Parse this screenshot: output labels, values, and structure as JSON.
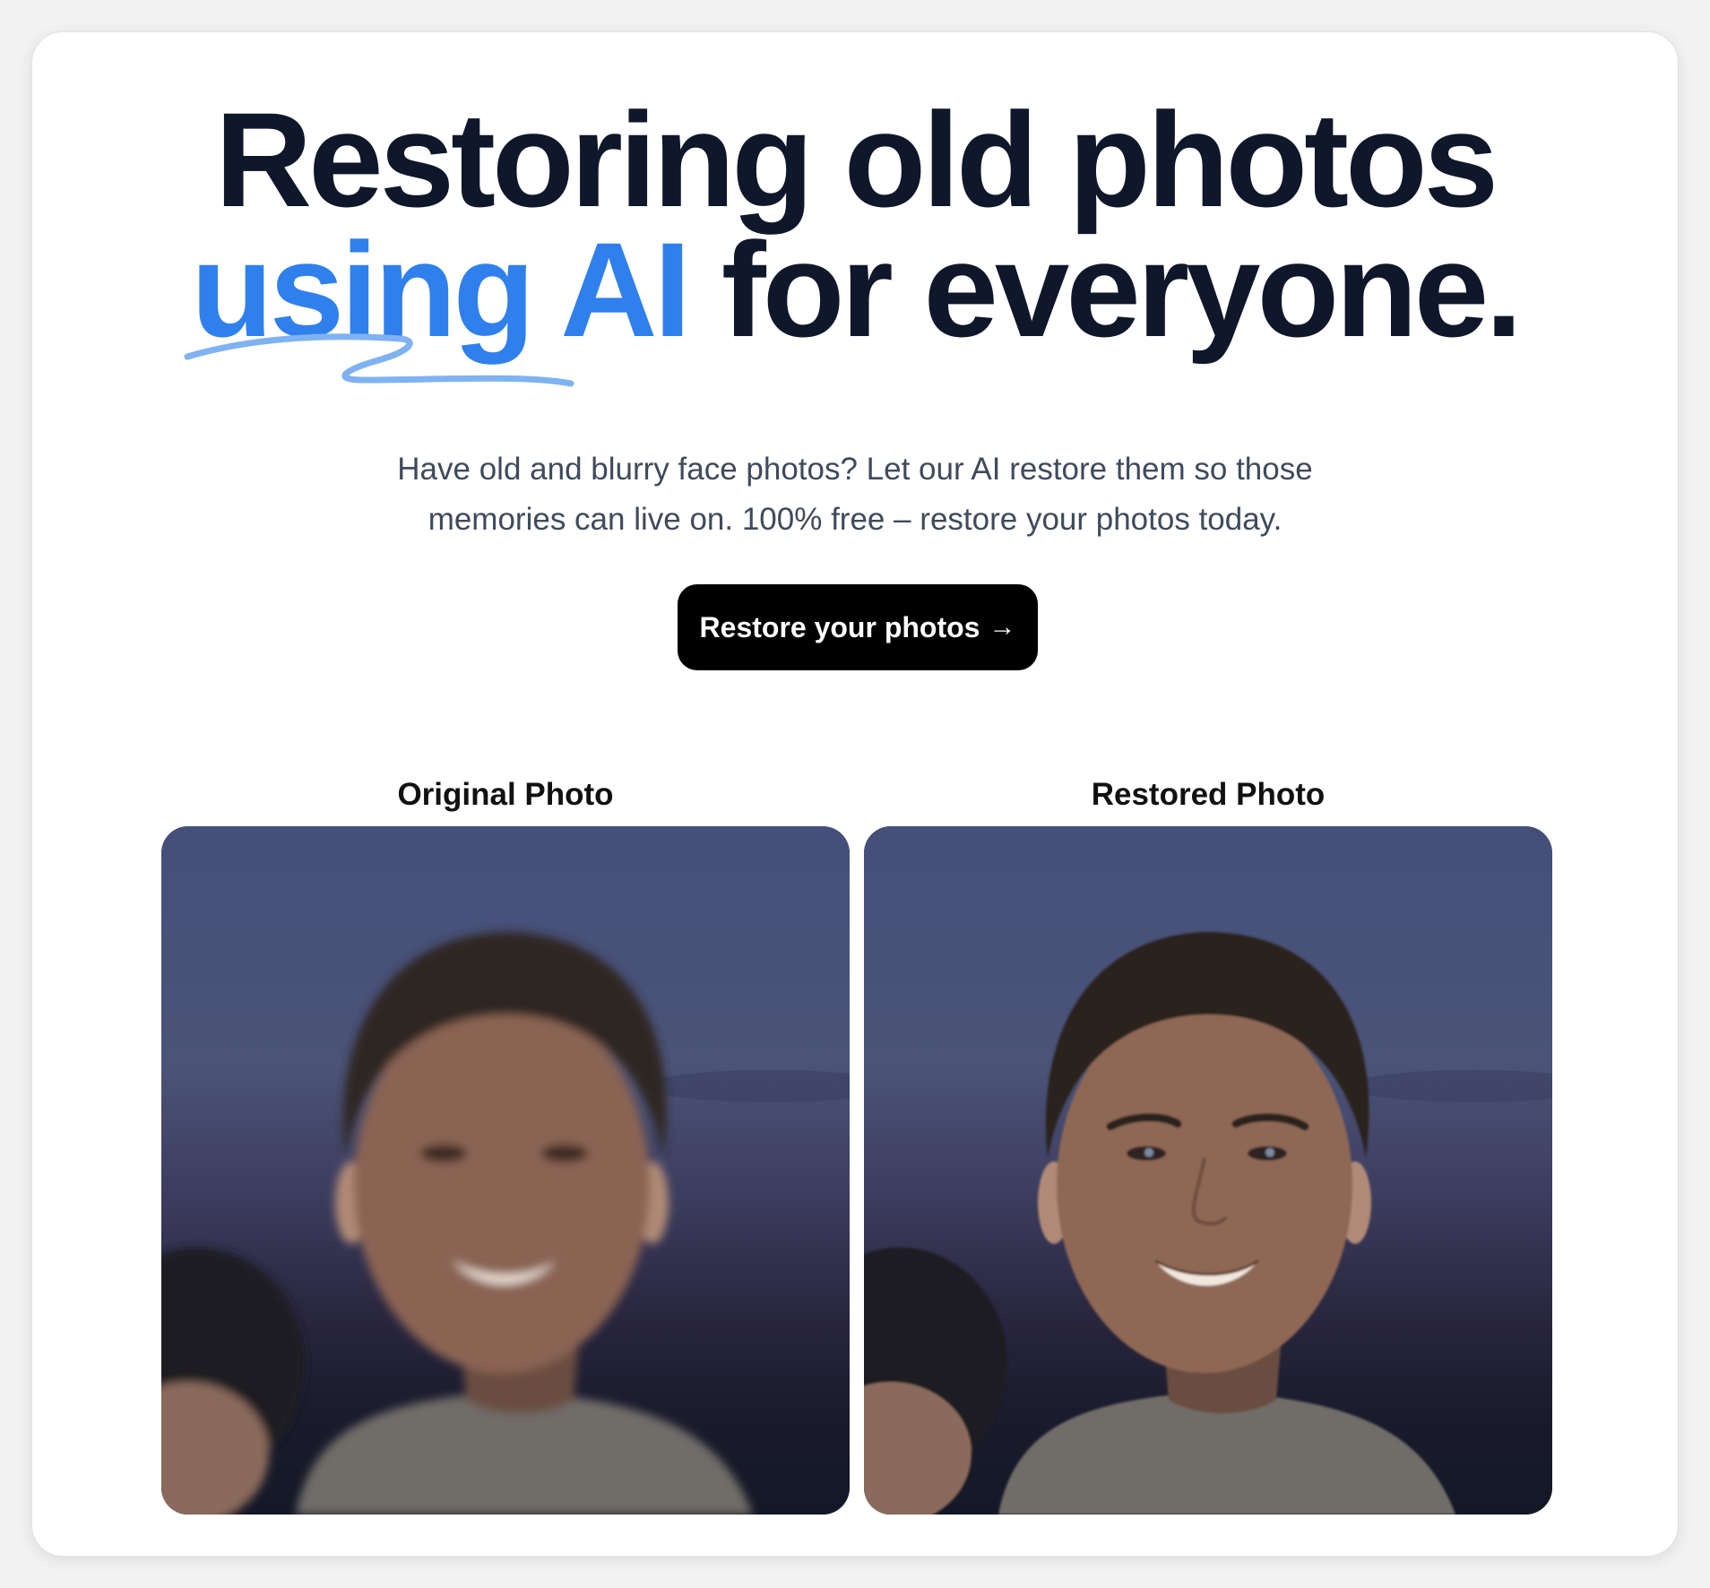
{
  "hero": {
    "headline_line1": "Restoring old photos",
    "headline_accent": "using AI",
    "headline_rest": " for everyone.",
    "subtitle_line1": "Have old and blurry face photos? Let our AI restore them so those",
    "subtitle_line2": "memories can live on. 100% free – restore your photos today."
  },
  "cta": {
    "label": "Restore your photos",
    "arrow": "→"
  },
  "comparison": {
    "original_label": "Original Photo",
    "restored_label": "Restored Photo"
  },
  "colors": {
    "accent": "#2f80ed",
    "heading": "#0f172a",
    "button_bg": "#000000",
    "button_text": "#ffffff"
  }
}
